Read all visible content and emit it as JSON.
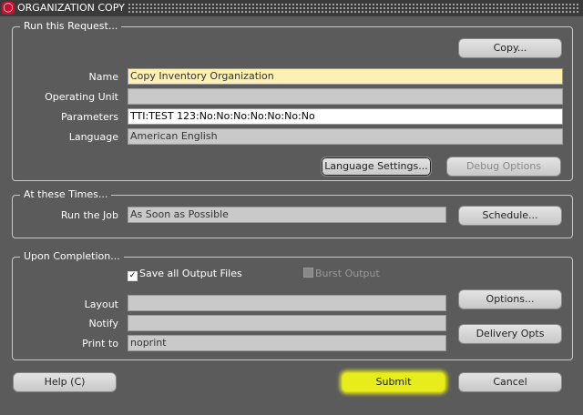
{
  "window": {
    "title": "ORGANIZATION COPY",
    "icon": "oracle-logo-icon"
  },
  "request": {
    "section_title": "Run this Request...",
    "copy_button": "Copy...",
    "name_label": "Name",
    "name_value": "Copy Inventory Organization",
    "operating_unit_label": "Operating Unit",
    "operating_unit_value": "",
    "parameters_label": "Parameters",
    "parameters_value": "TTI:TEST 123:No:No:No:No:No:No:No",
    "language_label": "Language",
    "language_value": "American English",
    "language_settings_button": "Language Settings...",
    "debug_options_button": "Debug Options"
  },
  "times": {
    "section_title": "At these Times...",
    "run_job_label": "Run the Job",
    "run_job_value": "As Soon as Possible",
    "schedule_button": "Schedule..."
  },
  "completion": {
    "section_title": "Upon Completion...",
    "save_output_label": "Save all Output Files",
    "save_output_checked": true,
    "burst_output_label": "Burst Output",
    "burst_output_checked": false,
    "layout_label": "Layout",
    "layout_value": "",
    "notify_label": "Notify",
    "notify_value": "",
    "print_to_label": "Print to",
    "print_to_value": "noprint",
    "options_button": "Options...",
    "delivery_opts_button": "Delivery Opts"
  },
  "footer": {
    "help_button": "Help (C)",
    "submit_button": "Submit",
    "cancel_button": "Cancel"
  },
  "colors": {
    "highlight": "#e8ec1a",
    "required_field": "#fcf0b4",
    "background": "#5b5b5b"
  }
}
